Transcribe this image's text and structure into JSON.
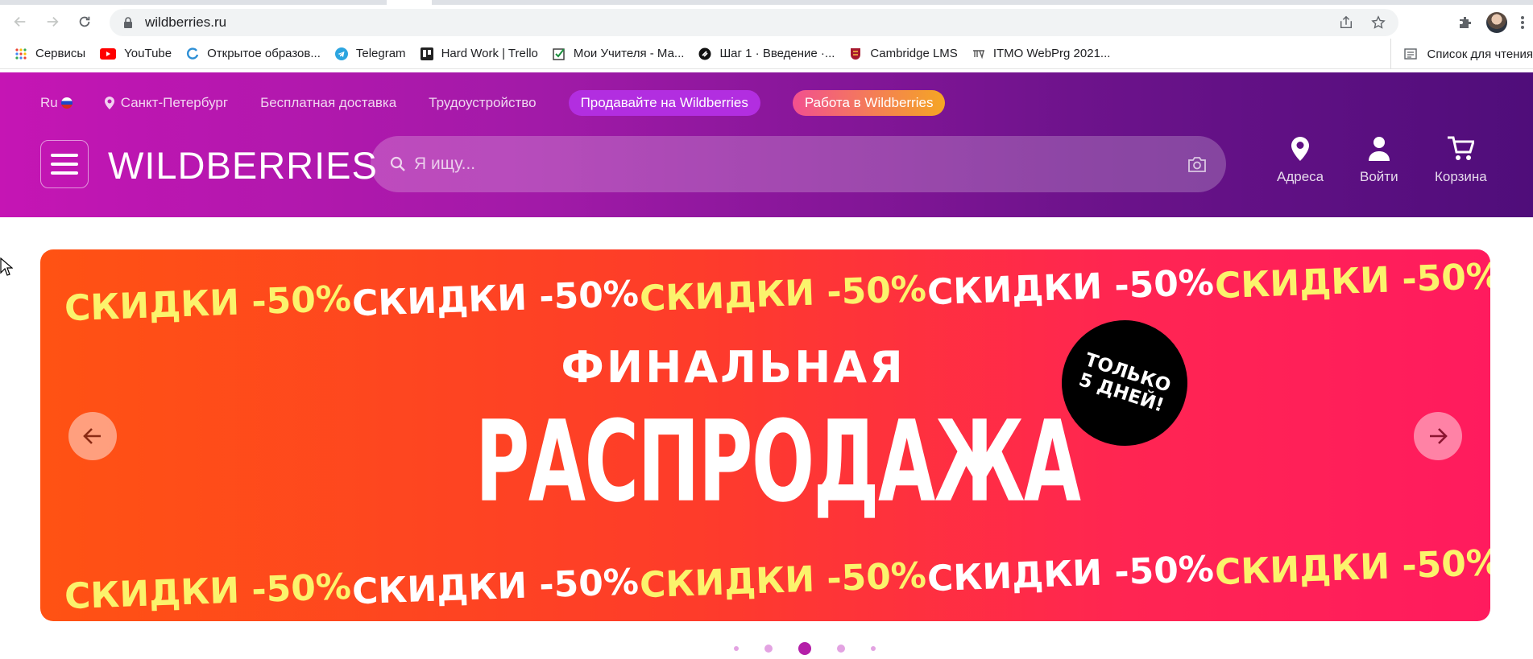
{
  "browser": {
    "url": "wildberries.ru",
    "bookmarks": [
      {
        "label": "Сервисы",
        "icon": "apps-grid-icon"
      },
      {
        "label": "YouTube",
        "icon": "youtube-icon"
      },
      {
        "label": "Открытое образов...",
        "icon": "open-education-icon"
      },
      {
        "label": "Telegram",
        "icon": "telegram-icon"
      },
      {
        "label": "Hard Work | Trello",
        "icon": "trello-icon"
      },
      {
        "label": "Мои Учителя - Ма...",
        "icon": "checkbox-icon"
      },
      {
        "label": "Шаг 1 · Введение ·...",
        "icon": "stepik-icon"
      },
      {
        "label": "Cambridge LMS",
        "icon": "cambridge-shield-icon"
      },
      {
        "label": "ITMO WebPrg 2021...",
        "icon": "itmo-icon"
      }
    ],
    "reading_list": "Список для чтения"
  },
  "header": {
    "lang": "Ru",
    "city": "Санкт-Петербург",
    "free_delivery": "Бесплатная доставка",
    "jobs": "Трудоустройство",
    "sell_button": "Продавайте на Wildberries",
    "work_button": "Работа в Wildberries",
    "logo": "WILDBERRIES",
    "search_placeholder": "Я ищу...",
    "addresses": "Адреса",
    "login": "Войти",
    "cart": "Корзина"
  },
  "banner": {
    "promo_text": "СКИДКИ -50%",
    "headline_small": "ФИНАЛЬНАЯ",
    "headline_big": "РАСПРОДАЖА",
    "badge_line1": "ТОЛЬКО",
    "badge_line2": "5 ДНЕЙ!"
  },
  "carousel": {
    "active_index": 2,
    "total": 5
  },
  "colors": {
    "brand_gradient_start": "#c515b4",
    "brand_gradient_end": "#4f0d7a",
    "banner_orange": "#ff5213",
    "banner_pink": "#ff1b5e",
    "promo_yellow": "#fbf36c"
  }
}
